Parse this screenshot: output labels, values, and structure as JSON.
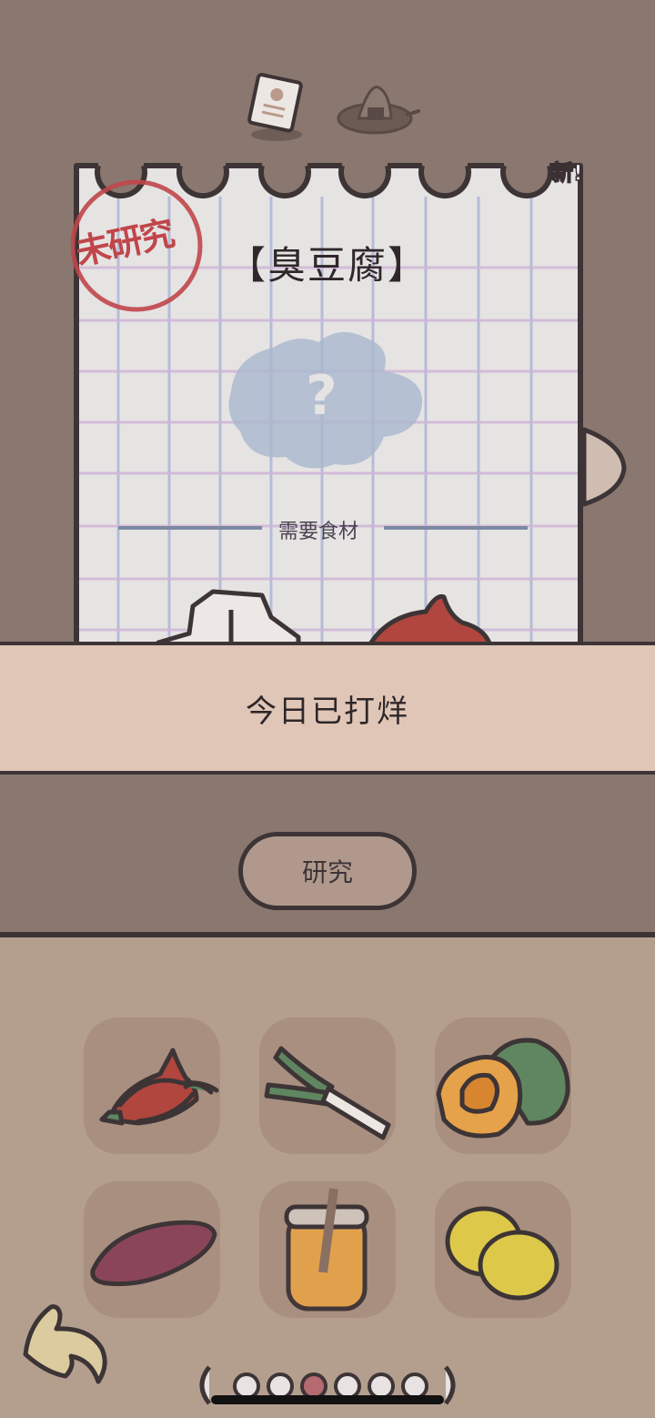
{
  "top_tabs": [
    "recipe-note",
    "rice-ball"
  ],
  "recipe": {
    "title": "【臭豆腐】",
    "stamp": "未研究",
    "new_badge": "新!",
    "ingredients_label": "需要食材",
    "image_placeholder": "?"
  },
  "status": "今日已打烊",
  "research_button": "研究",
  "inventory": [
    {
      "item": "chili-pepper-icon"
    },
    {
      "item": "green-onion-icon"
    },
    {
      "item": "pumpkin-icon"
    },
    {
      "item": "sweet-potato-icon"
    },
    {
      "item": "honey-jar-icon"
    },
    {
      "item": "lemon-icon"
    }
  ],
  "pager": {
    "total": 6,
    "current": 3
  },
  "colors": {
    "background": "#8a7870",
    "banner": "#dfc6b7",
    "panel": "#b49f8f",
    "slot": "#a88f80",
    "outline": "#3d3436",
    "stamp": "#c0464a",
    "active_dot": "#b56a70"
  }
}
